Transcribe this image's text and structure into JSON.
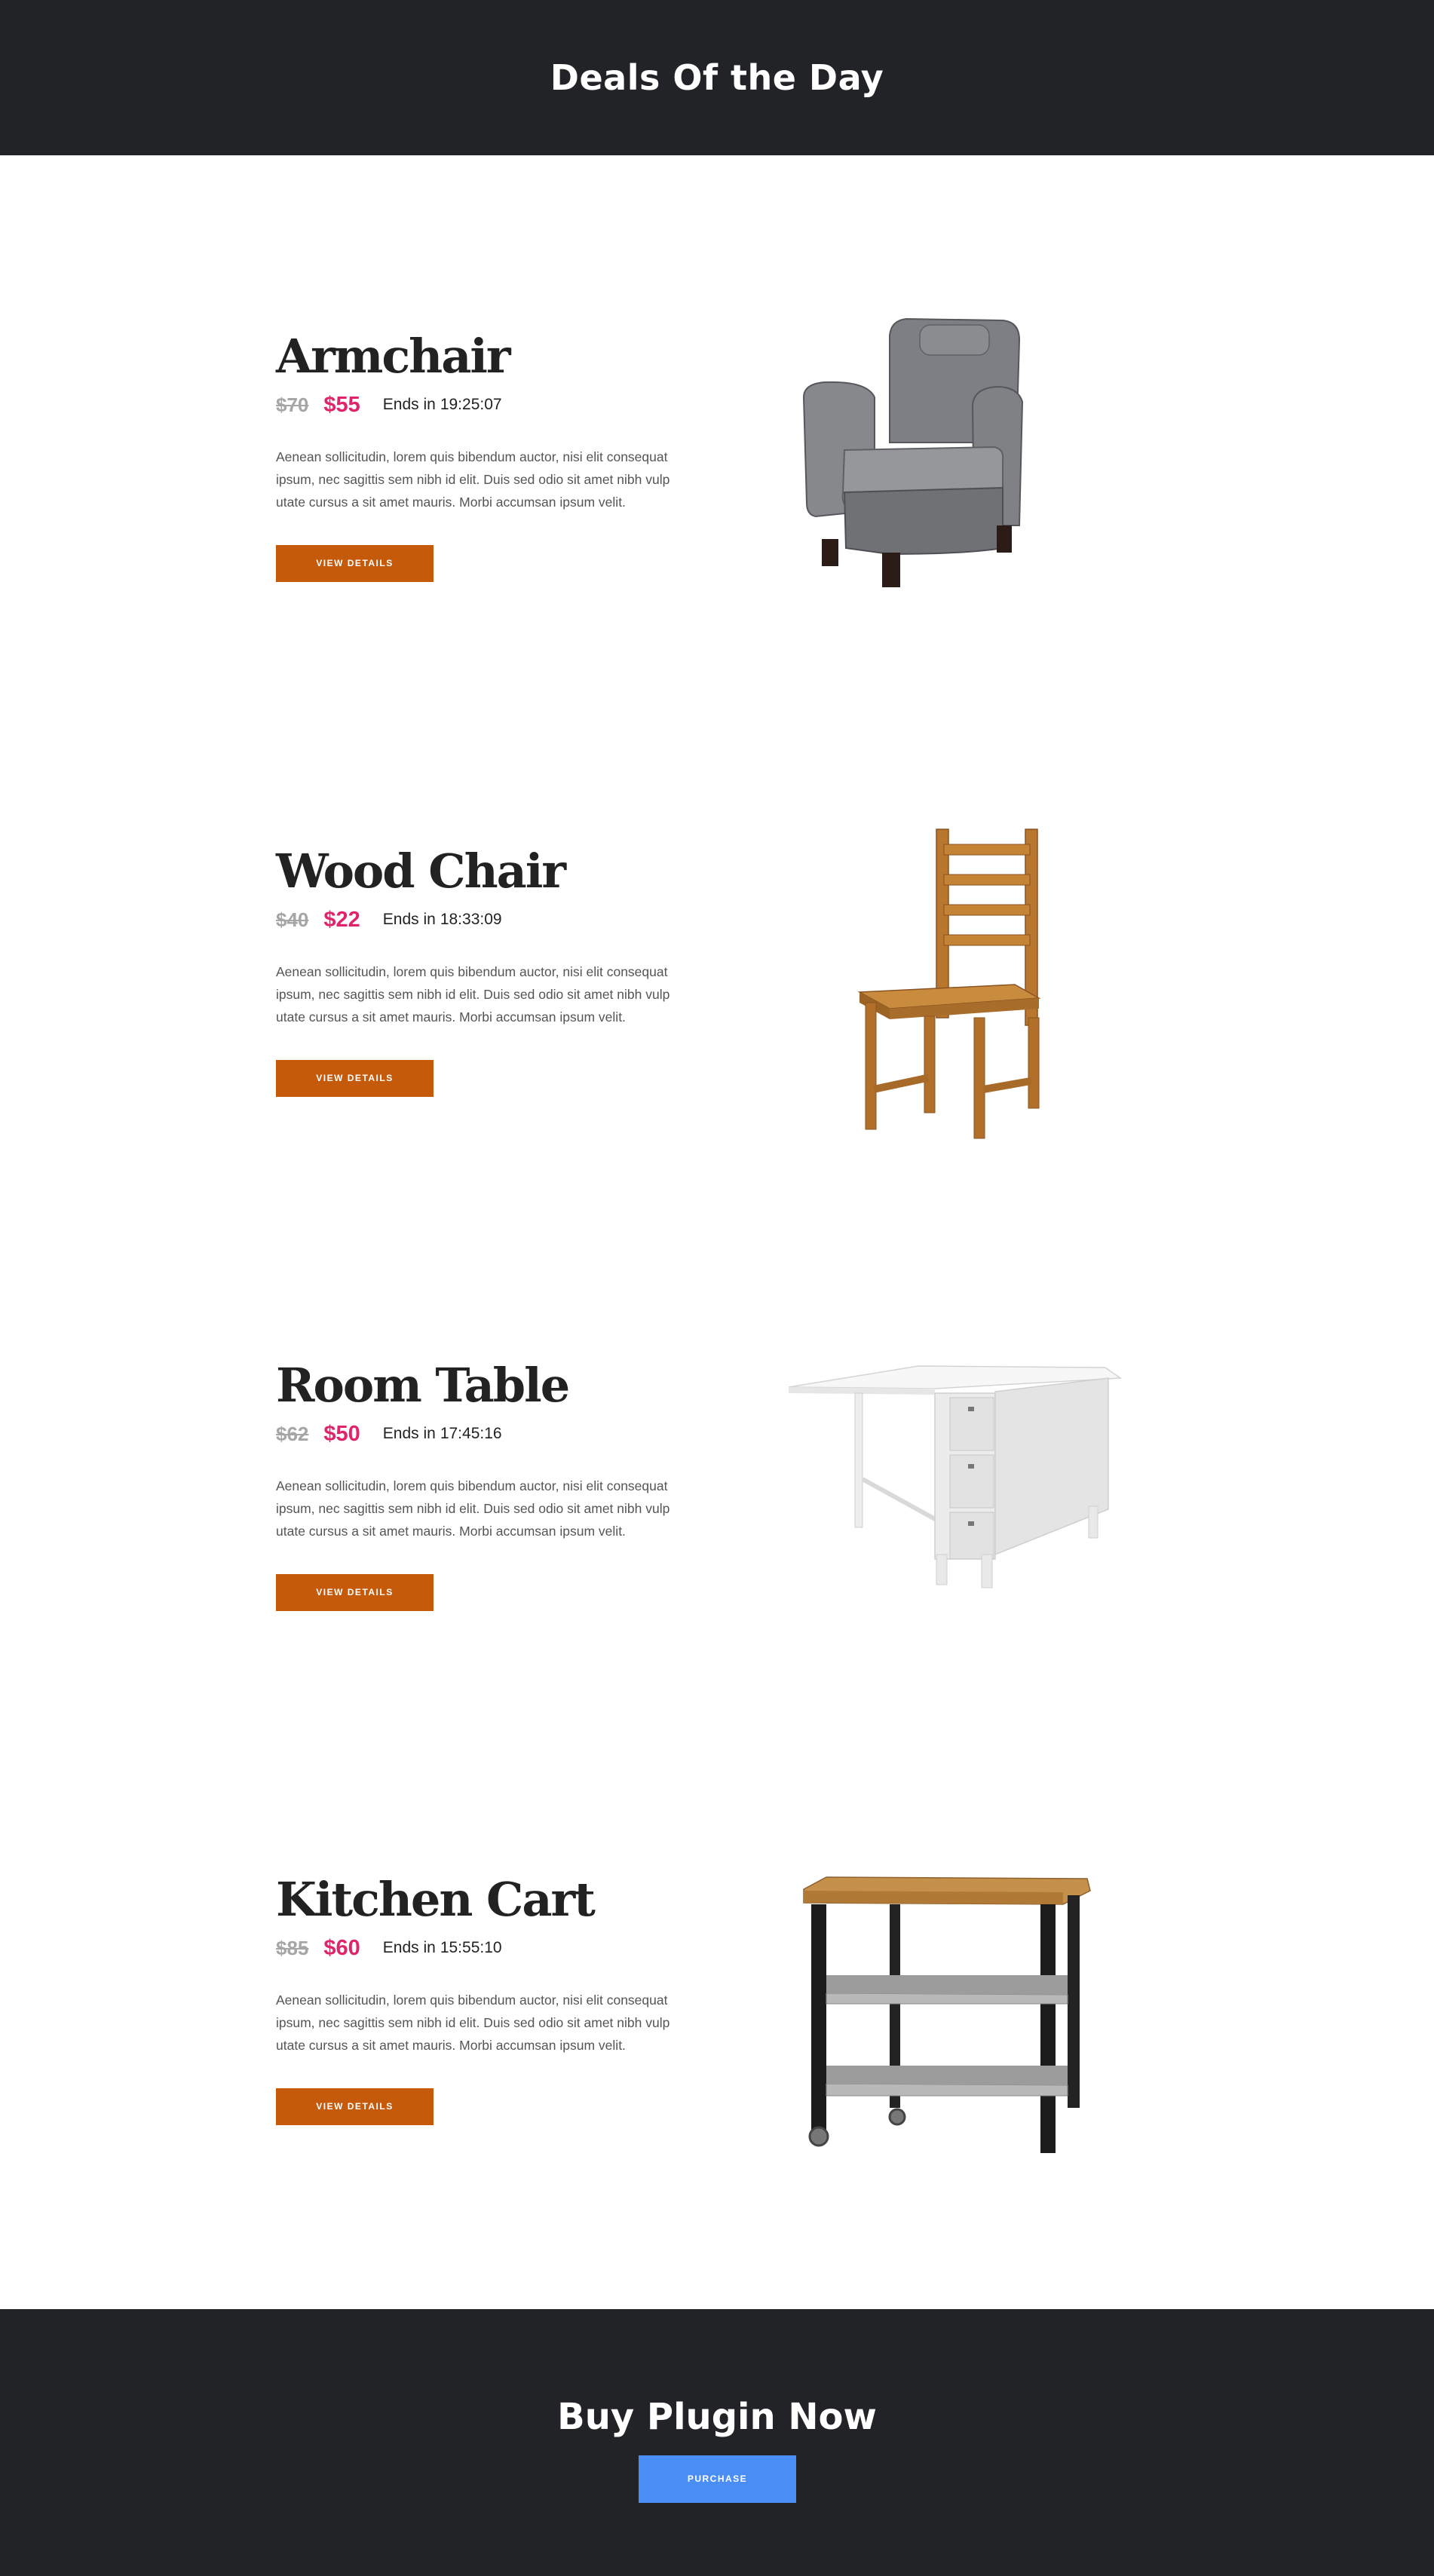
{
  "header": {
    "title": "Deals Of the Day"
  },
  "deals": [
    {
      "title": "Armchair",
      "old_price": "$70",
      "new_price": "$55",
      "ends_label": "Ends in",
      "timer": "19:25:07",
      "description": "Aenean sollicitudin, lorem quis bibendum auctor, nisi elit consequat ipsum, nec sagittis sem nibh id elit. Duis sed odio sit amet nibh vulp utate cursus a sit amet mauris. Morbi accumsan ipsum velit.",
      "button_label": "VIEW DETAILS",
      "image_icon": "armchair-image"
    },
    {
      "title": "Wood Chair",
      "old_price": "$40",
      "new_price": "$22",
      "ends_label": "Ends in",
      "timer": "18:33:09",
      "description": "Aenean sollicitudin, lorem quis bibendum auctor, nisi elit consequat ipsum, nec sagittis sem nibh id elit. Duis sed odio sit amet nibh vulp utate cursus a sit amet mauris. Morbi accumsan ipsum velit.",
      "button_label": "VIEW DETAILS",
      "image_icon": "wood-chair-image"
    },
    {
      "title": "Room Table",
      "old_price": "$62",
      "new_price": "$50",
      "ends_label": "Ends in",
      "timer": "17:45:16",
      "description": "Aenean sollicitudin, lorem quis bibendum auctor, nisi elit consequat ipsum, nec sagittis sem nibh id elit. Duis sed odio sit amet nibh vulp utate cursus a sit amet mauris. Morbi accumsan ipsum velit.",
      "button_label": "VIEW DETAILS",
      "image_icon": "room-table-image"
    },
    {
      "title": "Kitchen Cart",
      "old_price": "$85",
      "new_price": "$60",
      "ends_label": "Ends in",
      "timer": "15:55:10",
      "description": "Aenean sollicitudin, lorem quis bibendum auctor, nisi elit consequat ipsum, nec sagittis sem nibh id elit. Duis sed odio sit amet nibh vulp utate cursus a sit amet mauris. Morbi accumsan ipsum velit.",
      "button_label": "VIEW DETAILS",
      "image_icon": "kitchen-cart-image"
    }
  ],
  "footer": {
    "title": "Buy Plugin Now",
    "button_label": "PURCHASE"
  },
  "colors": {
    "dark_band": "#222326",
    "old_price": "#a6a6a6",
    "new_price": "#e0246b",
    "details_button": "#c55a0a",
    "purchase_button": "#4a8ef5"
  }
}
